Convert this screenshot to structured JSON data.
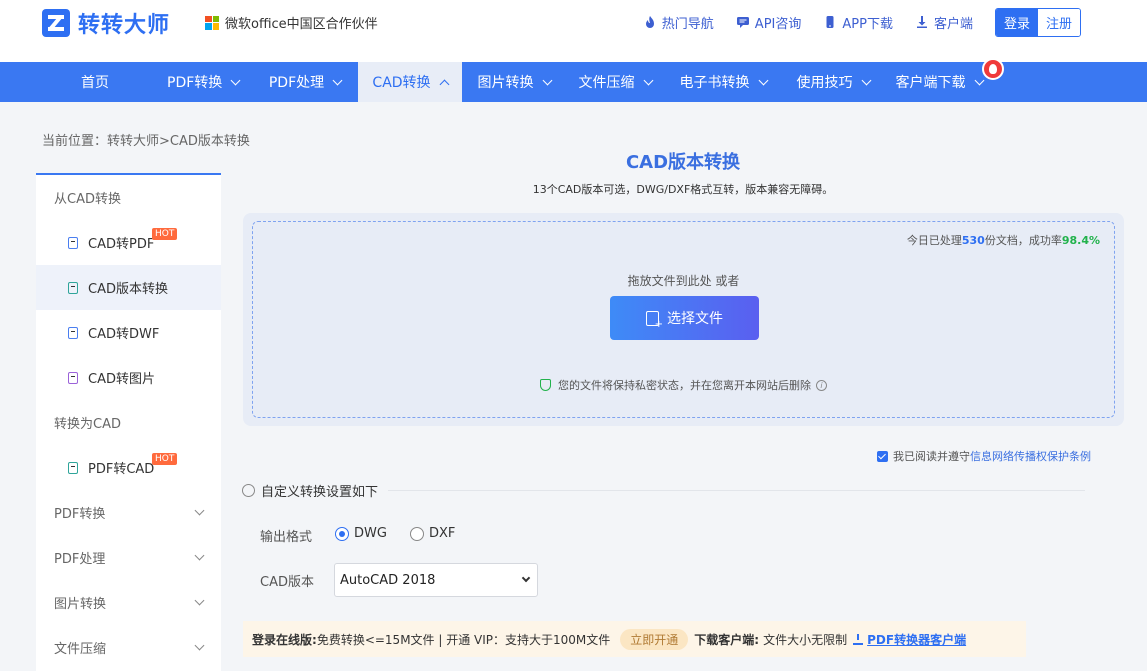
{
  "header": {
    "brand": "转转大师",
    "partner": "微软office中国区合作伙伴",
    "links": [
      {
        "label": "热门导航",
        "icon": "fire-icon"
      },
      {
        "label": "API咨询",
        "icon": "chat-icon"
      },
      {
        "label": "APP下载",
        "icon": "phone-icon"
      },
      {
        "label": "客户端",
        "icon": "download-icon"
      }
    ],
    "login": "登录",
    "register": "注册",
    "colors": {
      "brand": "#2e6ff2",
      "nav": "#3a78f2"
    }
  },
  "nav": {
    "items": [
      {
        "label": "首页"
      },
      {
        "label": "PDF转换"
      },
      {
        "label": "PDF处理"
      },
      {
        "label": "CAD转换"
      },
      {
        "label": "图片转换"
      },
      {
        "label": "文件压缩"
      },
      {
        "label": "电子书转换"
      },
      {
        "label": "使用技巧"
      },
      {
        "label": "客户端下载"
      }
    ]
  },
  "breadcrumb": "当前位置：转转大师>CAD版本转换",
  "sidebar": {
    "group_from_cad": "从CAD转换",
    "items_from_cad": [
      {
        "label": "CAD转PDF",
        "hot": "HOT"
      },
      {
        "label": "CAD版本转换"
      },
      {
        "label": "CAD转DWF"
      },
      {
        "label": "CAD转图片"
      }
    ],
    "group_to_cad": "转换为CAD",
    "items_to_cad": [
      {
        "label": "PDF转CAD",
        "hot": "HOT"
      }
    ],
    "collapsed_groups": [
      "PDF转换",
      "PDF处理",
      "图片转换",
      "文件压缩"
    ]
  },
  "main": {
    "title": "CAD版本转换",
    "subtitle": "13个CAD版本可选，DWG/DXF格式互转，版本兼容无障碍。",
    "stats": {
      "prefix": "今日已处理",
      "count": "530",
      "mid": "份文档，成功率",
      "rate": "98.4%"
    },
    "drop_text": "拖放文件到此处 或者",
    "choose_button": "选择文件",
    "privacy": "您的文件将保持私密状态，并在您离开本网站后删除",
    "agree_prefix": "我已阅读并遵守",
    "agree_link": "信息网络传播权保护条例",
    "settings_title": "自定义转换设置如下",
    "format_label": "输出格式",
    "format_options": [
      "DWG",
      "DXF"
    ],
    "version_label": "CAD版本",
    "version_value": "AutoCAD 2018"
  },
  "promo": {
    "login_label": "登录在线版:",
    "login_text": "免费转换<=15M文件 | 开通 VIP：支持大于100M文件",
    "open_button": "立即开通",
    "download_label": "下载客户端:",
    "download_text": "文件大小无限制",
    "download_link": "PDF转换器客户端"
  }
}
